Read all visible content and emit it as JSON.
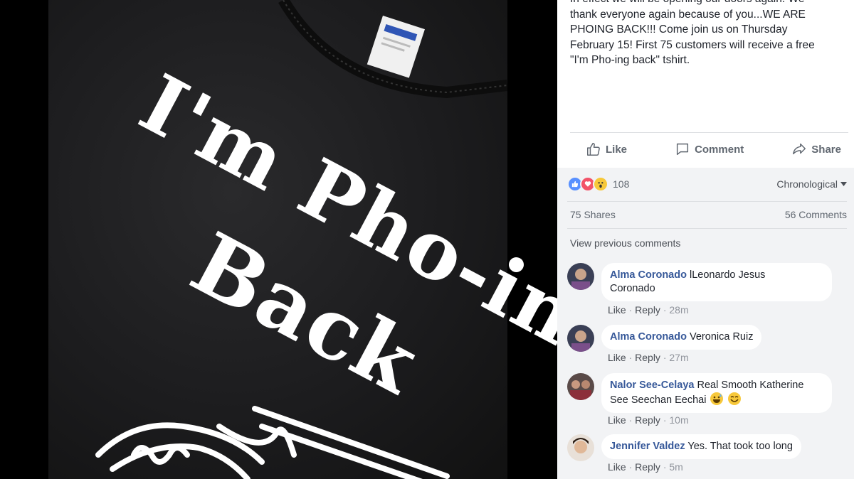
{
  "post": {
    "text_lines": [
      "In effect we will be opening our doors again. We",
      "thank everyone again because of you...WE ARE",
      "PHOING BACK!!! Come join us on Thursday",
      "February 15! First 75 customers will receive a free",
      "\"I'm Pho-ing back\" tshirt."
    ]
  },
  "shirt": {
    "line1": "I'm Pho-ing",
    "line2": "Back"
  },
  "actions": {
    "like": "Like",
    "comment": "Comment",
    "share": "Share"
  },
  "reactions": {
    "count": "108",
    "icons": [
      "like-icon",
      "love-icon",
      "wow-icon"
    ],
    "colors": {
      "like": "#5890ff",
      "love": "#f25268",
      "wow": "#f7c83a"
    }
  },
  "sort_label": "Chronological",
  "stats": {
    "shares": "75 Shares",
    "comments": "56 Comments"
  },
  "view_previous": "View previous comments",
  "comments": [
    {
      "author": "Alma Coronado",
      "text": "lLeonardo Jesus",
      "text2": "Coronado",
      "like": "Like",
      "reply": "Reply",
      "time": "28m"
    },
    {
      "author": "Alma Coronado",
      "text": "Veronica Ruiz",
      "like": "Like",
      "reply": "Reply",
      "time": "27m"
    },
    {
      "author": "Nalor See-Celaya",
      "text": "Real Smooth Katherine",
      "text2": "See Seechan Eechai",
      "like": "Like",
      "reply": "Reply",
      "time": "10m"
    },
    {
      "author": "Jennifer Valdez",
      "text": "Yes. That took too long",
      "like": "Like",
      "reply": "Reply",
      "time": "5m"
    }
  ],
  "separator": "·"
}
